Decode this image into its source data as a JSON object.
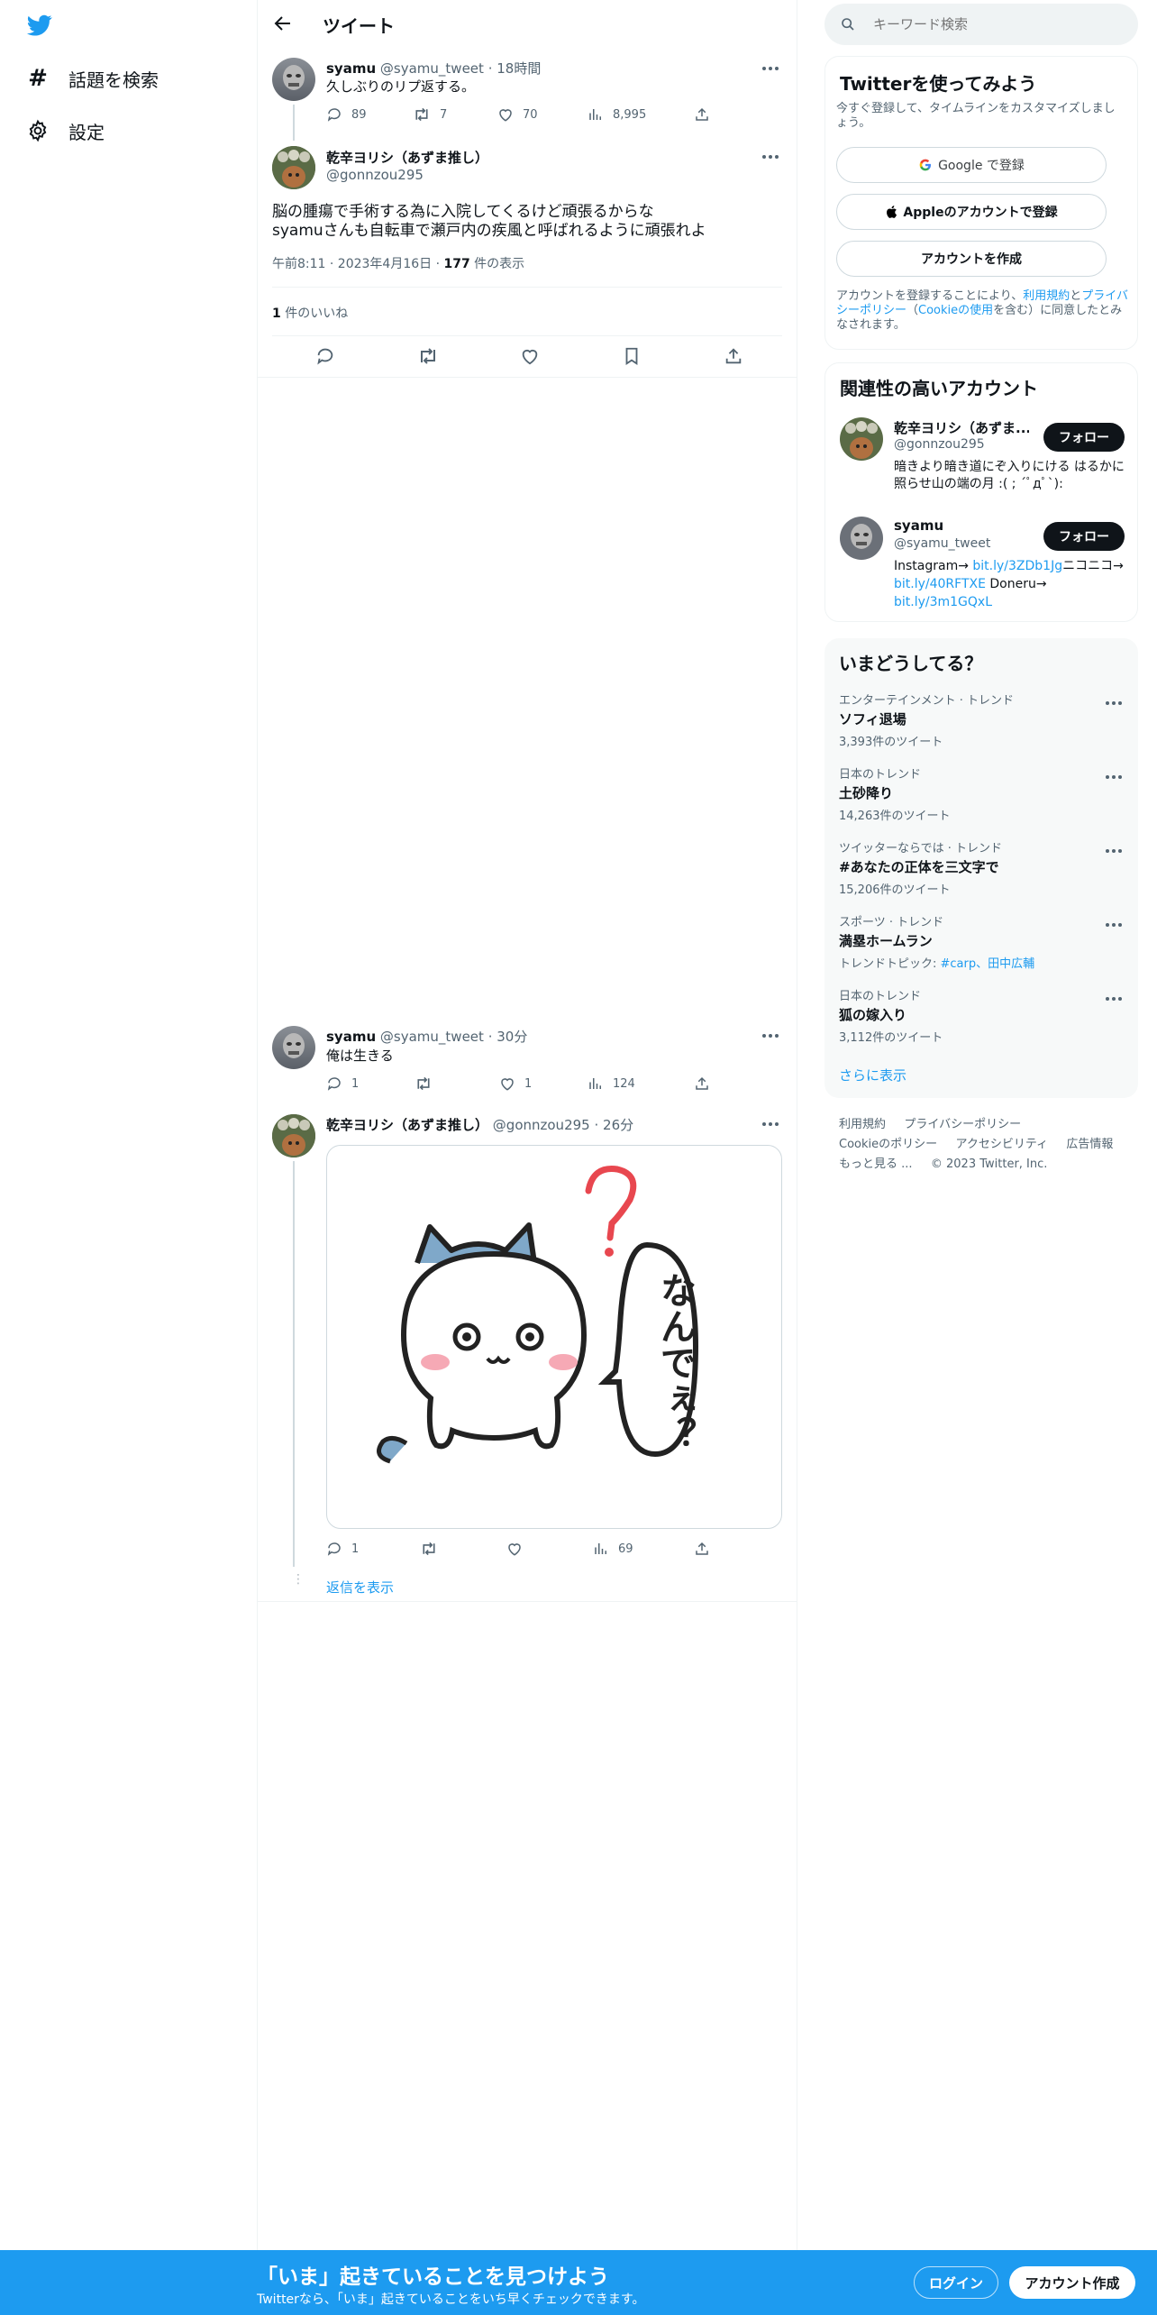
{
  "nav": {
    "explore_label": "話題を検索",
    "settings_label": "設定"
  },
  "header": {
    "title": "ツイート"
  },
  "search": {
    "placeholder": "キーワード検索"
  },
  "thread": {
    "parent": {
      "name": "syamu",
      "handle": "@syamu_tweet",
      "time": "18時間",
      "text": "久しぶりのリプ返する。",
      "replies": "89",
      "retweets": "7",
      "likes": "70",
      "views": "8,995"
    },
    "main": {
      "name": "乾辛ヨリシ（あずま推し）",
      "handle": "@gonnzou295",
      "text_line1": "脳の腫瘍で手術する為に入院してくるけど頑張るからな",
      "text_line2": "syamuさんも自転車で瀬戸内の疾風と呼ばれるように頑張れよ",
      "timestamp": "午前8:11 · 2023年4月16日 · ",
      "views_count": "177",
      "views_label": " 件の表示",
      "likes_count": "1",
      "likes_label": " 件のいいね"
    },
    "reply1": {
      "name": "syamu",
      "handle": "@syamu_tweet",
      "time": "30分",
      "text": "俺は生きる",
      "replies": "1",
      "likes": "1",
      "views": "124"
    },
    "reply2": {
      "name": "乾辛ヨリシ（あずま推し）",
      "handle": "@gonnzou295",
      "time": "26分",
      "image_text": "なんでぇ？",
      "replies": "1",
      "views": "69"
    },
    "show_replies": "返信を表示"
  },
  "signup": {
    "title": "Twitterを使ってみよう",
    "subtitle": "今すぐ登録して、タイムラインをカスタマイズしましょう。",
    "google_label": "Google で登録",
    "apple_label": "Appleのアカウントで登録",
    "create_label": "アカウントを作成",
    "terms_pre": "アカウントを登録することにより、",
    "terms_link1": "利用規約",
    "terms_mid1": "と",
    "terms_link2": "プライバシーポリシー",
    "terms_mid2": "（",
    "terms_link3": "Cookieの使用",
    "terms_post": "を含む）に同意したとみなされます。"
  },
  "related": {
    "title": "関連性の高いアカウント",
    "accounts": [
      {
        "name": "乾辛ヨリシ（あずま...",
        "handle": "@gonnzou295",
        "bio": "暗きより暗き道にぞ入りにける はるかに照らせ山の端の月 :( ; ´ﾟдﾟ`):",
        "follow": "フォロー"
      },
      {
        "name": "syamu",
        "handle": "@syamu_tweet",
        "bio_pre": "Instagram→ ",
        "bio_link1": "bit.ly/3ZDb1Jg",
        "bio_mid1": "ニコニコ→ ",
        "bio_link2": "bit.ly/40RFTXE",
        "bio_mid2": " Doneru→ ",
        "bio_link3": "bit.ly/3m1GQxL",
        "follow": "フォロー"
      }
    ]
  },
  "trends": {
    "title": "いまどうしてる？",
    "items": [
      {
        "meta": "エンターテインメント · トレンド",
        "name": "ソフィ退場",
        "count": "3,393件のツイート"
      },
      {
        "meta": "日本のトレンド",
        "name": "土砂降り",
        "count": "14,263件のツイート"
      },
      {
        "meta": "ツイッターならでは · トレンド",
        "name": "#あなたの正体を三文字で",
        "count": "15,206件のツイート"
      },
      {
        "meta": "スポーツ · トレンド",
        "name": "満塁ホームラン",
        "count_pre": "トレンドトピック: ",
        "count_link": "#carp、田中広輔"
      },
      {
        "meta": "日本のトレンド",
        "name": "狐の嫁入り",
        "count": "3,112件のツイート"
      }
    ],
    "show_more": "さらに表示"
  },
  "footer": {
    "terms": "利用規約",
    "privacy": "プライバシーポリシー",
    "cookie": "Cookieのポリシー",
    "accessibility": "アクセシビリティ",
    "ads": "広告情報",
    "more": "もっと見る ...",
    "copyright": "© 2023 Twitter, Inc."
  },
  "banner": {
    "title": "「いま」起きていることを見つけよう",
    "subtitle": "Twitterなら、「いま」起きていることをいち早くチェックできます。",
    "login": "ログイン",
    "signup": "アカウント作成"
  },
  "colors": {
    "brand": "#1d9bf0",
    "text": "#0f1419",
    "muted": "#536471",
    "border": "#eff3f4"
  }
}
